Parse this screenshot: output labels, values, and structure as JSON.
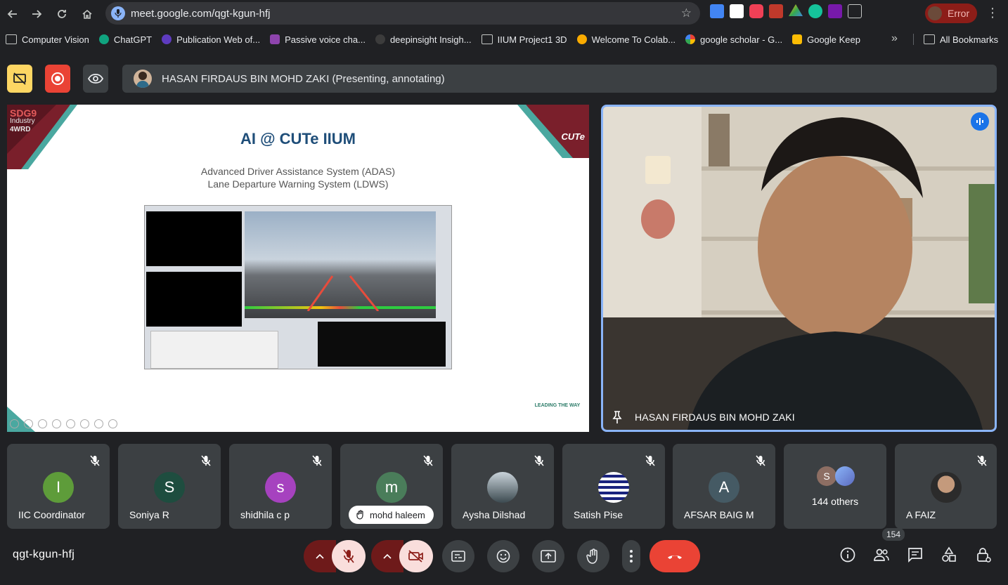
{
  "browser": {
    "url": "meet.google.com/qgt-kgun-hfj",
    "profile_label": "Error",
    "bookmarks": [
      "Computer Vision",
      "ChatGPT",
      "Publication Web of...",
      "Passive voice cha...",
      "deepinsight Insigh...",
      "IIUM Project1 3D",
      "Welcome To Colab...",
      "google scholar - G...",
      "Google Keep"
    ],
    "all_bookmarks": "All Bookmarks"
  },
  "meet": {
    "presenter_label": "HASAN FIRDAUS BIN MOHD ZAKI (Presenting, annotating)",
    "speaker_name": "HASAN FIRDAUS BIN MOHD ZAKI",
    "meeting_code": "qgt-kgun-hfj",
    "participant_count": "154",
    "slide": {
      "title": "AI @ CUTe IIUM",
      "subtitle1": "Advanced Driver Assistance System (ADAS)",
      "subtitle2": "Lane Departure Warning System (LDWS)",
      "logo_left_1": "SDG9",
      "logo_left_2": "Industry",
      "logo_left_3": "4WRD",
      "logo_right": "CUTe",
      "footer": "LEADING THE WAY"
    },
    "participants": [
      {
        "name": "IIC Coordinator",
        "initial": "I",
        "color": "#5e9c3a"
      },
      {
        "name": "Soniya R",
        "initial": "S",
        "color": "#1e4d3f"
      },
      {
        "name": "shidhila c p",
        "initial": "s",
        "color": "#a642bf"
      },
      {
        "name": "mohd haleem",
        "initial": "m",
        "color": "#4a7d5a"
      },
      {
        "name": "Aysha Dilshad",
        "initial": "",
        "color": "#8a9aa6"
      },
      {
        "name": "Satish Pise",
        "initial": "",
        "color": "#cfd8dc"
      },
      {
        "name": "AFSAR BAIG M",
        "initial": "A",
        "color": "#455a64"
      },
      {
        "name": "144 others",
        "initial": "S",
        "color": "#8d6e63"
      },
      {
        "name": "A FAIZ",
        "initial": "",
        "color": "#d7ccc8"
      }
    ]
  }
}
